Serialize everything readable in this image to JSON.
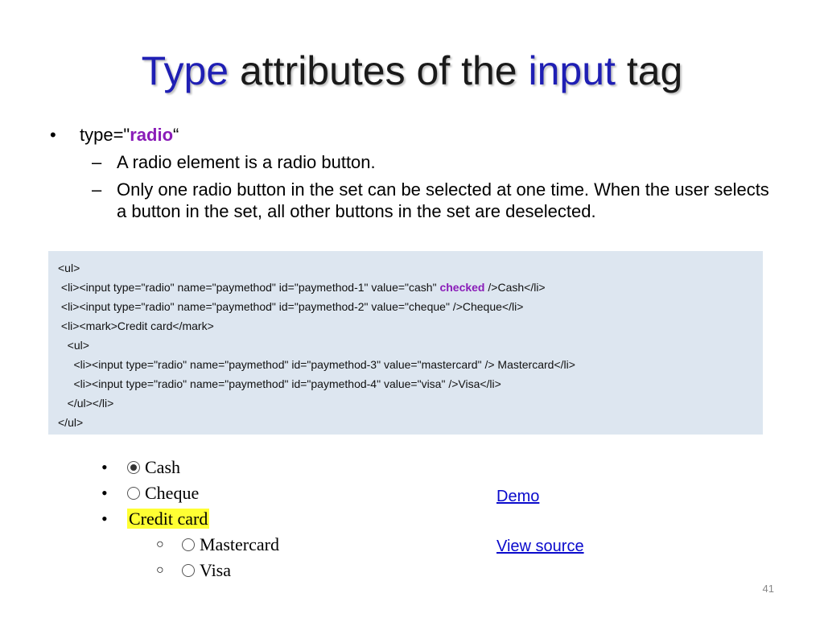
{
  "title": {
    "part1": "Type",
    "part2": " attributes of the ",
    "part3": "input",
    "part4": " tag"
  },
  "bullet": {
    "prefix": "type=\"",
    "keyword": "radio",
    "suffix": "“",
    "sub1": "A radio element is a radio button.",
    "sub2": "Only one radio button in the set can be selected at one time. When the user selects a button in the set, all other buttons in the set are deselected."
  },
  "code": {
    "line1": "<ul>",
    "line2_pre": " <li><input type=\"radio\" name=\"paymethod\" id=\"paymethod-1\" value=\"cash\" ",
    "line2_kw": "checked",
    "line2_post": " />Cash</li>",
    "line3": " <li><input type=\"radio\" name=\"paymethod\" id=\"paymethod-2\" value=\"cheque\" />Cheque</li>",
    "line4": " <li><mark>Credit card</mark>",
    "line5": "   <ul>",
    "line6": "     <li><input type=\"radio\" name=\"paymethod\" id=\"paymethod-3\" value=\"mastercard\" /> Mastercard</li>",
    "line7": "     <li><input type=\"radio\" name=\"paymethod\" id=\"paymethod-4\" value=\"visa\" />Visa</li>",
    "line8": "   </ul></li>",
    "line9": "</ul>"
  },
  "demo": {
    "cash": "Cash",
    "cheque": "Cheque",
    "credit": "Credit card",
    "mastercard": "Mastercard",
    "visa": "Visa"
  },
  "links": {
    "demo": "Demo",
    "source": "View source"
  },
  "page_number": "41",
  "colors": {
    "keyword_blue": "#1f1fb4",
    "keyword_purple": "#8a1cb8",
    "code_bg": "#dde6f0",
    "highlight": "#ffff33",
    "link": "#0a0acc"
  }
}
